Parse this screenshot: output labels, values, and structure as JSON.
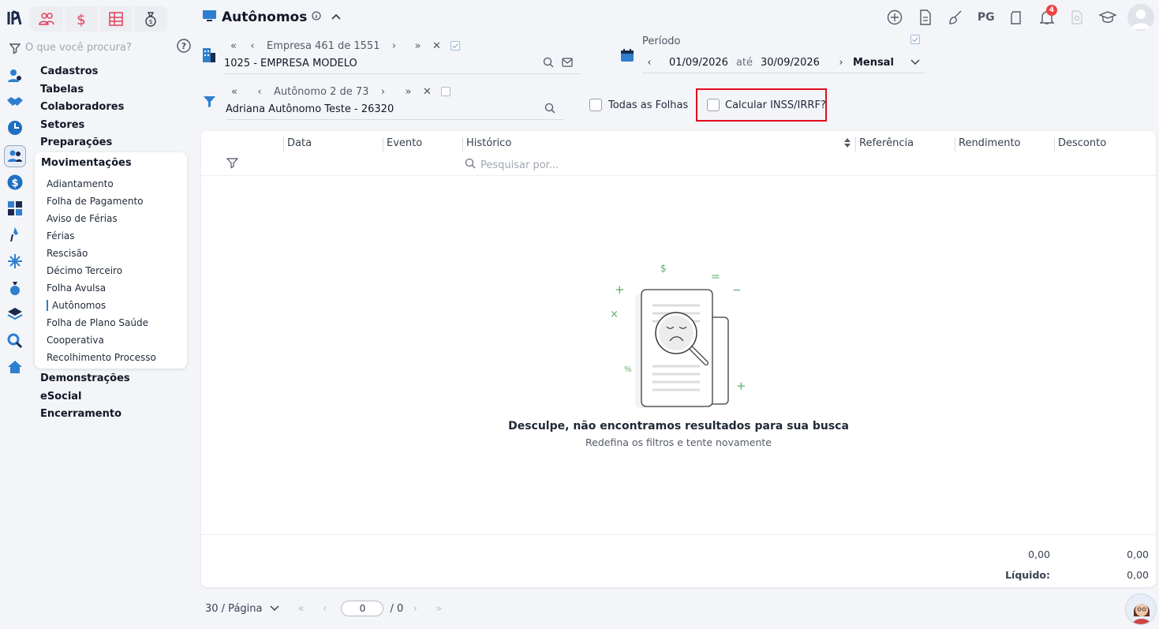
{
  "app": {
    "logo": "brand-logo",
    "page_title": "Autônomos"
  },
  "menu": {
    "search_placeholder": "O que você procura?",
    "sections_top": [
      "Cadastros",
      "Tabelas",
      "Colaboradores",
      "Setores",
      "Preparações"
    ],
    "open_section": "Movimentações",
    "open_items": [
      "Adiantamento",
      "Folha de Pagamento",
      "Aviso de Férias",
      "Férias",
      "Rescisão",
      "Décimo Terceiro",
      "Folha Avulsa",
      "Autônomos",
      "Folha de Plano Saúde",
      "Cooperativa",
      "Recolhimento Processo"
    ],
    "active_item": "Autônomos",
    "sections_bottom": [
      "Demonstrações",
      "eSocial",
      "Encerramento"
    ]
  },
  "topbar": {
    "pg_label": "PG",
    "notification_count": "4"
  },
  "empresa": {
    "nav_label": "Empresa 461 de 1551",
    "value": "1025 - EMPRESA MODELO"
  },
  "periodo": {
    "label": "Período",
    "start": "01/09/2026",
    "until": "até",
    "end": "30/09/2026",
    "frequency": "Mensal"
  },
  "autonomo": {
    "nav_label": "Autônomo 2 de 73",
    "value": "Adriana Autônomo Teste - 26320"
  },
  "options": {
    "todas_folhas": "Todas as Folhas",
    "calcular": "Calcular INSS/IRRF?"
  },
  "table": {
    "columns": [
      "Data",
      "Evento",
      "Histórico",
      "Referência",
      "Rendimento",
      "Desconto"
    ],
    "search_placeholder": "Pesquisar por...",
    "empty_title": "Desculpe, não encontramos resultados para sua busca",
    "empty_subtitle": "Redefina os filtros e tente novamente",
    "total_rendimento": "0,00",
    "total_desconto": "0,00",
    "liquido_label": "Líquido:",
    "liquido_value": "0,00"
  },
  "pager": {
    "per_page": "30 / Página",
    "current_page": "0",
    "total_pages": "/ 0"
  },
  "colors": {
    "accent": "#2e7fd0",
    "highlight": "#e10c1c",
    "badge": "#ef4444"
  }
}
